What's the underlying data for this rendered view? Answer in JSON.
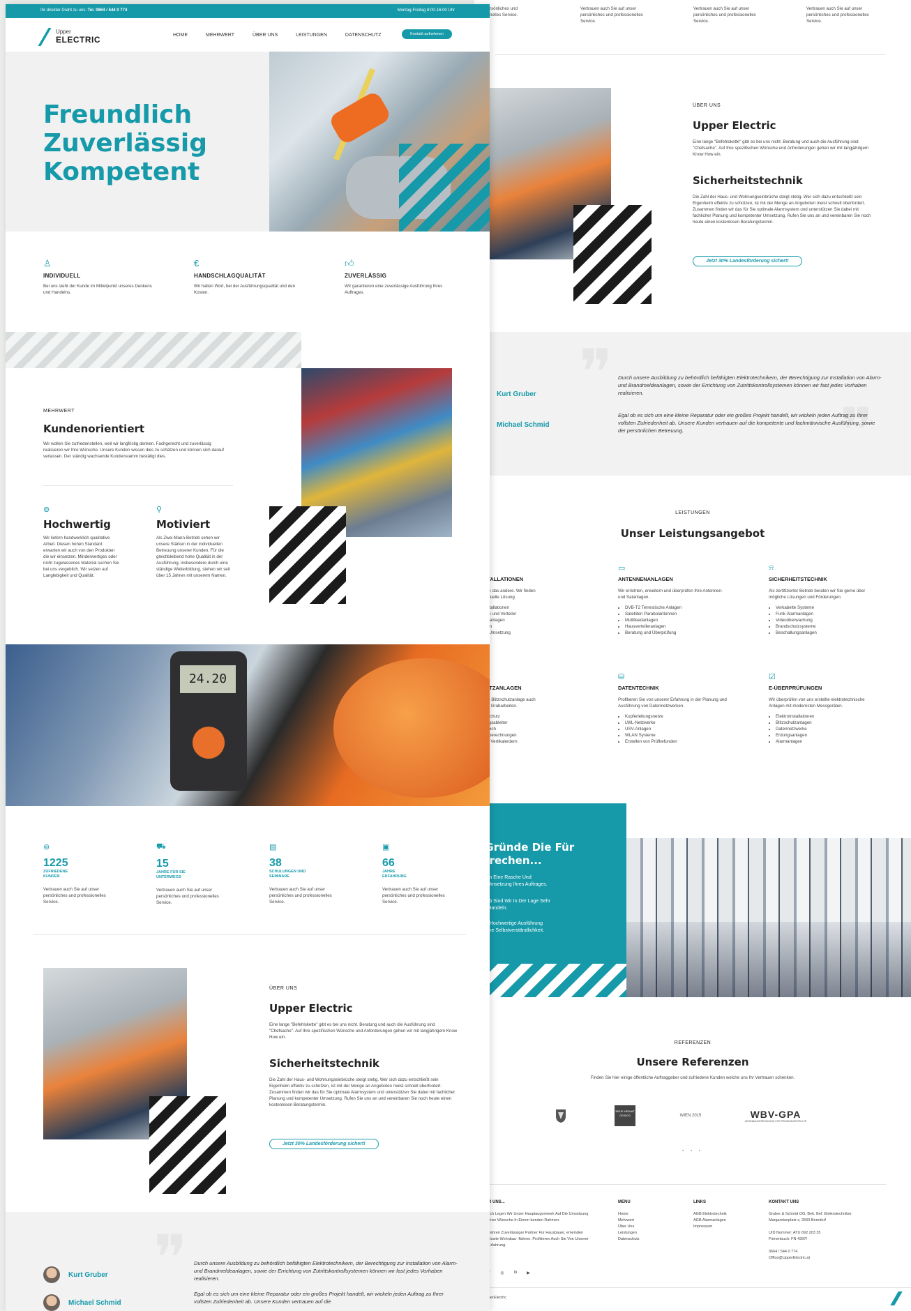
{
  "colors": {
    "accent": "#169aaa",
    "dark": "#1b1b1b"
  },
  "left": {
    "topbar": {
      "left_prefix": "Ihr direkter Draht zu uns:",
      "phone": "Tel. 0664 / 544 0 774",
      "hours": "Montag-Freitag 8:00-16:00 Uhr"
    },
    "logo": {
      "upper": "Upper",
      "electric": "ELECTRIC"
    },
    "nav": {
      "items": [
        "HOME",
        "MEHRWERT",
        "ÜBER UNS",
        "LEISTUNGEN",
        "DATENSCHUTZ"
      ],
      "cta": "Kontakt aufnehmen"
    },
    "hero": {
      "line1": "Freundlich",
      "line2": "Zuverlässig",
      "line3": "Kompetent"
    },
    "features": [
      {
        "icon": "user-icon",
        "title": "INDIVIDUELL",
        "text": "Bei uns steht der Kunde im Mittelpunkt unseres Denkens und Handelns."
      },
      {
        "icon": "euro-icon",
        "title": "HANDSCHLAGQUALITÄT",
        "text": "Wir halten Wort, bei der Ausführungsqualität und den Kosten."
      },
      {
        "icon": "thumbs-up-icon",
        "title": "ZUVERLÄSSIG",
        "text": "Wir garantieren eine zuverlässige Ausführung Ihres Auftrages."
      }
    ],
    "mehrwert": {
      "label": "MEHRWERT",
      "title": "Kundenorientiert",
      "text": "Wir wollen Sie zufriedenstellen, weil wir langfristig denken. Fachgerecht und zuverlässig realisieren wir Ihre Wünsche. Unsere Kunden wissen dies zu schätzen und können sich darauf verlassen. Der ständig wachsende Kundenstamm bestätigt dies.",
      "cols": [
        {
          "title": "Hochwertig",
          "text": "Wir liefern handwerklich qualitative Arbeit. Diesen hohen Standard erwarten wir auch von den Produkten die wir einsetzen. Minderwertiges oder nicht zugelassenes Material suchen Sie bei uns vergeblich. Wir setzen auf Langlebigkeit und Qualität."
        },
        {
          "title": "Motiviert",
          "text": "Als Zwei-Mann-Betrieb sehen wir unsere Stärken in der individuellen Betreuung unserer Kunden. Für die gleichbleibend hohe Qualität in der Ausführung, insbesondere durch eine ständige Weiterbildung, stehen wir seit über 15 Jahren mit unserem Namen."
        }
      ]
    },
    "meter_reading": "24.20",
    "stats": [
      {
        "num": "1225",
        "l1": "ZUFRIEDENE",
        "l2": "KUNDEN",
        "text": "Vertrauen auch Sie auf unser persönliches und professionelles Service."
      },
      {
        "num": "15",
        "l1": "JAHRE FÜR SIE",
        "l2": "UNTERWEGS",
        "text": "Vertrauen auch Sie auf unser persönliches und professionelles Service."
      },
      {
        "num": "38",
        "l1": "SCHULUNGEN UND",
        "l2": "SEMINARE",
        "text": "Vertrauen auch Sie auf unser persönliches und professionelles Service."
      },
      {
        "num": "66",
        "l1": "JAHRE",
        "l2": "ERFAHRUNG",
        "text": "Vertrauen auch Sie auf unser persönliches und professionelles Service."
      }
    ],
    "about": {
      "label": "ÜBER UNS",
      "title": "Upper Electric",
      "text": "Eine lange \"Befehlskette\" gibt es bei uns nicht. Beratung und auch die Ausführung sind \"Chefsache\". Auf Ihre spezifischen Wünsche und Anforderungen gehen wir mit langjährigem Know How ein.",
      "title2": "Sicherheitstechnik",
      "text2": "Die Zahl der Haus- und Wohnungseinbrüche steigt stetig. Wer sich dazu entschließt sein Eigenheim effektiv zu schützen, ist mit der Menge an Angeboten meist schnell überfordert. Zusammen finden wir das für Sie optimale Alarmsystem und unterstützen Sie dabei mit fachlicher Planung und kompetenter Umsetzung. Rufen Sie uns an und vereinbaren Sie noch heute einen kostenlosen Beratungstermin.",
      "cta": "Jetzt 30% Landesförderung sichert!"
    },
    "testimonials": {
      "name1": "Kurt Gruber",
      "name2": "Michael Schmid",
      "text1": "Durch unsere Ausbildung zu behördlich befähigten Elektrotechnikern, der Berechtigung zur Installation von Alarm- und Brandmeldeanlagen, sowie der Errichtung von Zutrittskontrollsystemen können wir fast jedes Vorhaben realisieren.",
      "text2": "Egal ob es sich um eine kleine Reparatur oder ein großes Projekt handelt, wir wickeln jeden Auftrag zu Ihrer vollsten Zufriedenheit ab. Unsere Kunden vertrauen auf die"
    }
  },
  "right": {
    "top_cols": [
      "Vertrauen auch Sie auf unser persönliches und professionelles Service.",
      "Vertrauen auch Sie auf unser persönliches und professionelles Service.",
      "Vertrauen auch Sie auf unser persönliches und professionelles Service.",
      "Vertrauen auch Sie auf unser persönliches und professionelles Service."
    ],
    "top_col0": "rsönliches und\nnelles Service.",
    "about": {
      "label": "ÜBER UNS",
      "title": "Upper Electric",
      "text": "Eine lange \"Befehlskette\" gibt es bei uns nicht. Beratung und auch die Ausführung sind \"Chefsache\". Auf Ihre spezifischen Wünsche und Anforderungen gehen wir mit langjährigem Know How ein.",
      "title2": "Sicherheitstechnik",
      "text2": "Die Zahl der Haus- und Wohnungseinbrüche steigt stetig. Wer sich dazu entschließt sein Eigenheim effektiv zu schützen, ist mit der Menge an Angeboten meist schnell überfordert. Zusammen finden wir das für Sie optimale Alarmsystem und unterstützen Sie dabei mit fachlicher Planung und kompetenter Umsetzung. Rufen Sie uns an und vereinbaren Sie noch heute einen kostenlosen Beratungstermin.",
      "cta": "Jetzt 30% Landesförderung sichert!"
    },
    "testimonials": {
      "name1": "Kurt Gruber",
      "name2": "Michael Schmid",
      "text1": "Durch unsere Ausbildung zu behördlich befähigten Elektrotechnikern, der Berechtigung zur Installation von Alarm- und Brandmeldeanlagen, sowie der Errichtung von Zutrittskontrollsystemen können wir fast jedes Vorhaben realisieren.",
      "text2": "Egal ob es sich um eine kleine Reparatur oder ein großes Projekt handelt, wir wickeln jeden Auftrag zu Ihrer vollsten Zufriedenheit ab. Unsere Kunden vertrauen auf die kompetente und fachmännische Ausführung, sowie der persönlichen Betreuung."
    },
    "services": {
      "label": "LEISTUNGEN",
      "title": "Unser Leistungsangebot",
      "items": [
        {
          "icon": "plug-icon",
          "title": "OINSTALLATIONEN",
          "text": "kt ist wie das andere. Wir finden\ne individuelle Lösung.",
          "list": [
            "eine Installationen",
            "eitungen und Verteiler",
            "chtungsanlagen",
            "sanlagen",
            "ng und Umsetzung"
          ]
        },
        {
          "icon": "monitor-icon",
          "title": "ANTENNENANLAGEN",
          "text": "Wir errichten, erweitern und überprüfen Ihre Antennen- und Satanlagen.",
          "list": [
            "DVB-T2 Terrestische Anlagen",
            "Satelliten Parabolantennen",
            "Multifeedanlagen",
            "Hausverteileranlagen",
            "Beratung und Überprüfung"
          ]
        },
        {
          "icon": "bell-icon",
          "title": "SICHERHEITSTECHNIK",
          "text": "Als zertifizierter Betrieb beraten wir Sie gerne über mögliche Lösungen und Förderungen.",
          "list": [
            "Verkabelte Systeme",
            "Funk-Alarmanlagen",
            "Videoüberwachung",
            "Brandschutzsysteme",
            "Beschallungsanlagen"
          ]
        },
        {
          "icon": "bolt-icon",
          "title": "SCHUTZANLAGEN",
          "text": "hen Ihre Blitzschutzanlage auch\nch ohne Grabarbeiten.",
          "list": [
            "er Blitzschutz",
            "pannungsableiter",
            "alausgleich",
            "klassenberechnungen",
            "zen von Vertikalerdern"
          ]
        },
        {
          "icon": "database-icon",
          "title": "DATENTECHNIK",
          "text": "Profitieren Sie von unserer Erfahrung in der Planung und Ausführung von Datennetzwerken.",
          "list": [
            "Kupferleitungsnetze",
            "LWL-Netzwerke",
            "USV-Anlagen",
            "WLAN Systeme",
            "Erstellen von Prüfbefunden"
          ]
        },
        {
          "icon": "checklist-icon",
          "title": "E-ÜBERPRÜFUNGEN",
          "text": "Wir überprüfen von uns erstellte elektrotechnische Anlagen mit modernsten Messgeräten.",
          "list": [
            "Elektroinstallationen",
            "Blitzschutzanlagen",
            "Datennetzwerke",
            "Erdungsanlagen",
            "Alarmanlagen"
          ]
        }
      ]
    },
    "reasons": {
      "title": "e Gründe Die Für\nSprechen...",
      "r1": "antieren Eine Rasche Und\nssige Umsetzung Ihres Auftrages.",
      "r2": "nbetrieb Sind Wir In Der Lage Sehr\ntig Zu Handeln.",
      "r3": "alitativ Hochwertige Ausführung\nUns Eine Selbstverständlichkeit."
    },
    "references": {
      "label": "REFERENZEN",
      "title": "Unsere Referenzen",
      "text": "Finden Sie hier einige öffentliche Auftraggeber und zufriedene Kunden welche uns Ihr Vertrauen schenken.",
      "logo2": "NEUE HEIMAT GEWOG",
      "logo3": "WIEN 2015",
      "logo4": "WBV-GPA",
      "logo4_sub": "WOHNBAUVEREINIGUNG FÜR PRIVATANGESTELLTE",
      "dots": "• • •"
    },
    "footer": {
      "c1_title": "R UNS...",
      "c1_text": "lich Legen Wir Unser Hauptaugenmerk Auf Die Umsetzung Ihrer Wünsche In Einem benden Rahmen.\n\nJahren Zuverlässiger Partner Für Hausbauer, emeinden Sowie Wohnbau- ffahren. Profitieren Auch Sie Von Unserer Erfahrung.",
      "c2_title": "MENU",
      "c2_items": [
        "Home",
        "Mehrwert",
        "Über Uns",
        "Leistungen",
        "Datenschutz"
      ],
      "c3_title": "LINKS",
      "c3_items": [
        "AGB Elektrotechnik",
        "AGB Alarmanlagen",
        "Impressum"
      ],
      "c4_title": "KONTAKT UNS",
      "c4_text": "Gruber & Schmid OG, Beh. Bef. Elektrotechniker\nMargaretenplatz x, 2560 Berndorf\n\nUID Nummer: ATU 692 203 35\nFirmenbuch: FN 4397f\n\n0664 / 544 0 774\nOffice@UpperElectric.at",
      "copyright": "perElectric"
    }
  }
}
